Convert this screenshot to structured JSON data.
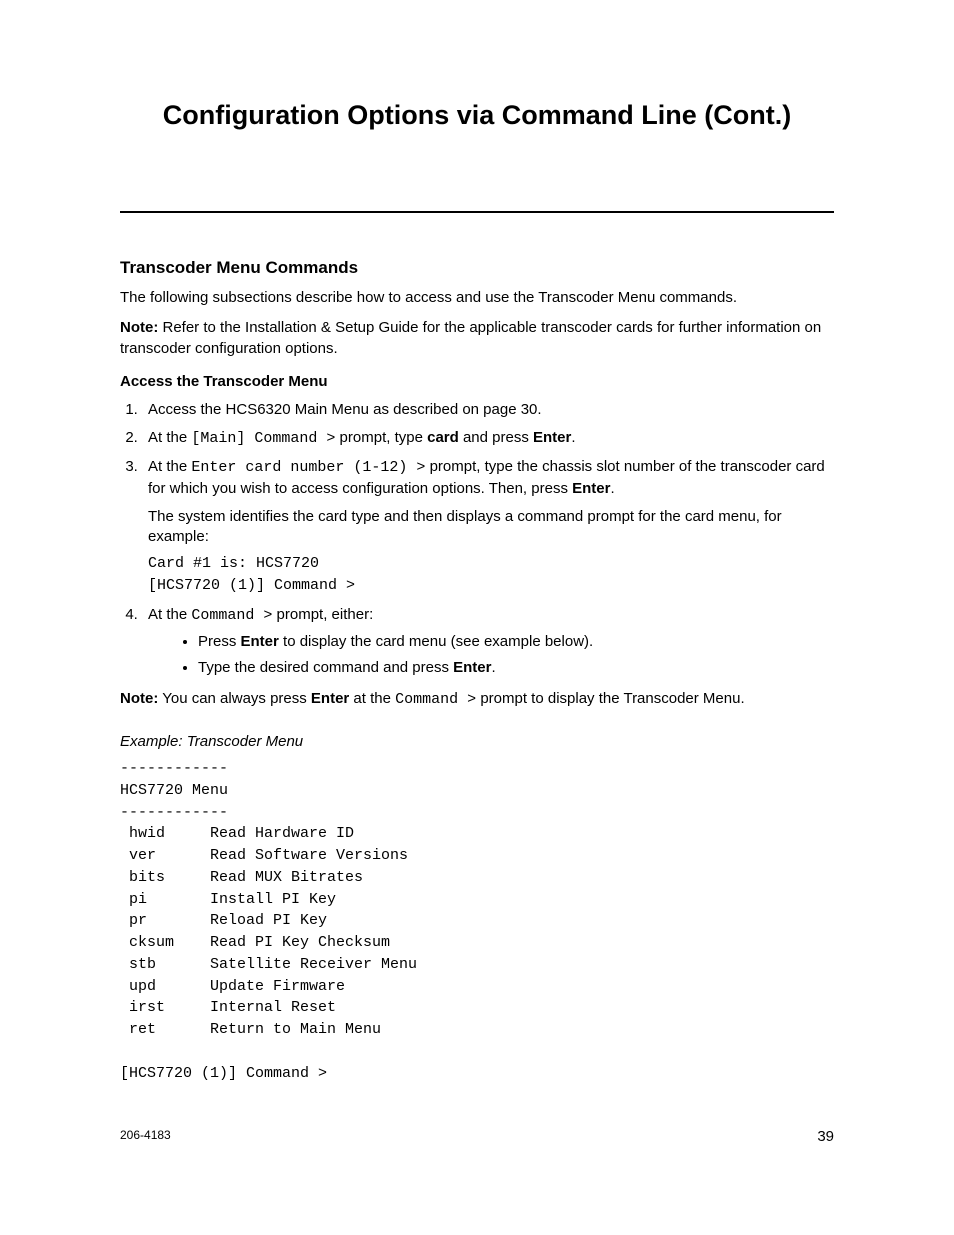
{
  "title": "Configuration Options via Command Line (Cont.)",
  "section_heading": "Transcoder Menu Commands",
  "intro": "The following subsections describe how to access and use the Transcoder Menu commands.",
  "note1_label": "Note:",
  "note1_text": " Refer to the Installation & Setup Guide for the applicable transcoder cards for further information on transcoder configuration options.",
  "subsection_heading": "Access the Transcoder Menu",
  "step1": "Access the HCS6320 Main Menu as described on page 30.",
  "step2_a": "At the ",
  "step2_code": "[Main] Command >",
  "step2_b": " prompt, type ",
  "step2_bold": "card",
  "step2_c": " and press ",
  "step2_enter": "Enter",
  "step2_d": ".",
  "step3_a": "At the ",
  "step3_code": "Enter card number (1-12) >",
  "step3_b": " prompt, type the chassis slot number of the transcoder card for which you wish to access configuration options. Then, press ",
  "step3_enter": "Enter",
  "step3_c": ".",
  "step3_sub": "The system identifies the card type and then displays a command prompt for the card menu, for example:",
  "code_block": "Card #1 is: HCS7720\n[HCS7720 (1)] Command >",
  "step4_a": "At the ",
  "step4_code": "Command >",
  "step4_b": " prompt, either:",
  "bullet1_a": "Press ",
  "bullet1_enter": "Enter",
  "bullet1_b": " to display the card menu (see example below).",
  "bullet2_a": "Type the desired command and press ",
  "bullet2_enter": "Enter",
  "bullet2_b": ".",
  "note2_label": "Note:",
  "note2_a": " You can always press ",
  "note2_enter": "Enter",
  "note2_b": " at the ",
  "note2_code": "Command >",
  "note2_c": " prompt to display the Transcoder Menu.",
  "example_label": "Example: Transcoder Menu",
  "menu_block": "------------\nHCS7720 Menu\n------------\n hwid     Read Hardware ID\n ver      Read Software Versions\n bits     Read MUX Bitrates\n pi       Install PI Key\n pr       Reload PI Key\n cksum    Read PI Key Checksum\n stb      Satellite Receiver Menu\n upd      Update Firmware\n irst     Internal Reset\n ret      Return to Main Menu\n\n[HCS7720 (1)] Command >",
  "footer_left": "206-4183",
  "footer_right": "39"
}
